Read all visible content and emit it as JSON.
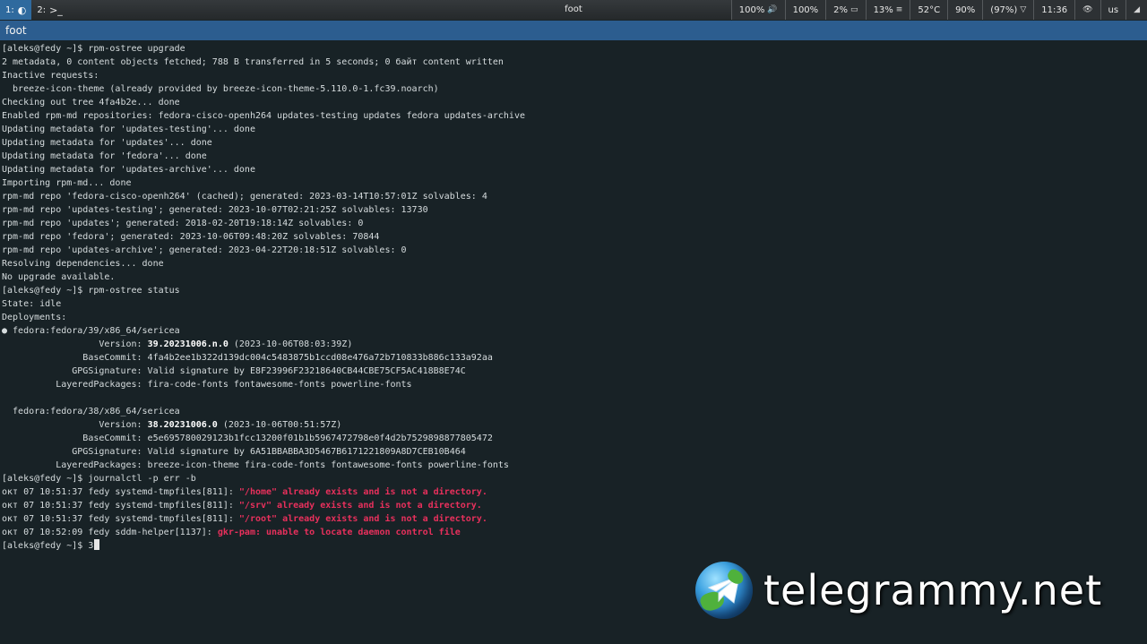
{
  "topbar": {
    "workspaces": [
      {
        "label": "1:",
        "glyph": "◐",
        "icon": "terminal-icon",
        "active": true
      },
      {
        "label": "2:",
        "glyph": ">_",
        "icon": "terminal-icon",
        "active": false
      }
    ],
    "title": "foot",
    "status": [
      {
        "text": "100%",
        "glyph": "🔊",
        "icon": "volume-icon"
      },
      {
        "text": "100%",
        "glyph": "",
        "icon": ""
      },
      {
        "text": "2%",
        "glyph": "▭",
        "icon": "cpu-icon"
      },
      {
        "text": "13%",
        "glyph": "≡",
        "icon": "memory-icon"
      },
      {
        "text": "52°C",
        "glyph": "",
        "icon": ""
      },
      {
        "text": "90%",
        "glyph": "",
        "icon": ""
      },
      {
        "text": "(97%)",
        "glyph": "▽",
        "icon": "wifi-icon"
      },
      {
        "text": "11:36",
        "glyph": "",
        "icon": ""
      },
      {
        "text": "",
        "glyph": "👁",
        "icon": "eye-icon"
      },
      {
        "text": "us",
        "glyph": "",
        "icon": ""
      },
      {
        "text": "",
        "glyph": "◢",
        "icon": "network-signal-icon"
      }
    ]
  },
  "window": {
    "title": "foot"
  },
  "terminal": {
    "lines": [
      [
        {
          "t": "[aleks@fedy ~]$ rpm-ostree upgrade"
        }
      ],
      [
        {
          "t": "2 metadata, 0 content objects fetched; 788 B transferred in 5 seconds; 0 байт content written"
        }
      ],
      [
        {
          "t": "Inactive requests:"
        }
      ],
      [
        {
          "t": "  breeze-icon-theme (already provided by breeze-icon-theme-5.110.0-1.fc39.noarch)"
        }
      ],
      [
        {
          "t": "Checking out tree 4fa4b2e... done"
        }
      ],
      [
        {
          "t": "Enabled rpm-md repositories: fedora-cisco-openh264 updates-testing updates fedora updates-archive"
        }
      ],
      [
        {
          "t": "Updating metadata for 'updates-testing'... done"
        }
      ],
      [
        {
          "t": "Updating metadata for 'updates'... done"
        }
      ],
      [
        {
          "t": "Updating metadata for 'fedora'... done"
        }
      ],
      [
        {
          "t": "Updating metadata for 'updates-archive'... done"
        }
      ],
      [
        {
          "t": "Importing rpm-md... done"
        }
      ],
      [
        {
          "t": "rpm-md repo 'fedora-cisco-openh264' (cached); generated: 2023-03-14T10:57:01Z solvables: 4"
        }
      ],
      [
        {
          "t": "rpm-md repo 'updates-testing'; generated: 2023-10-07T02:21:25Z solvables: 13730"
        }
      ],
      [
        {
          "t": "rpm-md repo 'updates'; generated: 2018-02-20T19:18:14Z solvables: 0"
        }
      ],
      [
        {
          "t": "rpm-md repo 'fedora'; generated: 2023-10-06T09:48:20Z solvables: 70844"
        }
      ],
      [
        {
          "t": "rpm-md repo 'updates-archive'; generated: 2023-04-22T20:18:51Z solvables: 0"
        }
      ],
      [
        {
          "t": "Resolving dependencies... done"
        }
      ],
      [
        {
          "t": "No upgrade available."
        }
      ],
      [
        {
          "t": "[aleks@fedy ~]$ rpm-ostree status"
        }
      ],
      [
        {
          "t": "State: idle"
        }
      ],
      [
        {
          "t": "Deployments:"
        }
      ],
      [
        {
          "t": "● fedora:fedora/39/x86_64/sericea"
        }
      ],
      [
        {
          "t": "                  Version: "
        },
        {
          "t": "39.20231006.n.0",
          "s": "b"
        },
        {
          "t": " (2023-10-06T08:03:39Z)"
        }
      ],
      [
        {
          "t": "               BaseCommit: 4fa4b2ee1b322d139dc004c5483875b1ccd08e476a72b710833b886c133a92aa"
        }
      ],
      [
        {
          "t": "             GPGSignature: Valid signature by E8F23996F23218640CB44CBE75CF5AC418B8E74C"
        }
      ],
      [
        {
          "t": "          LayeredPackages: fira-code-fonts fontawesome-fonts powerline-fonts"
        }
      ],
      [
        {
          "t": ""
        }
      ],
      [
        {
          "t": "  fedora:fedora/38/x86_64/sericea"
        }
      ],
      [
        {
          "t": "                  Version: "
        },
        {
          "t": "38.20231006.0",
          "s": "b"
        },
        {
          "t": " (2023-10-06T00:51:57Z)"
        }
      ],
      [
        {
          "t": "               BaseCommit: e5e695780029123b1fcc13200f01b1b5967472798e0f4d2b7529898877805472"
        }
      ],
      [
        {
          "t": "             GPGSignature: Valid signature by 6A51BBABBA3D5467B6171221809A8D7CEB10B464"
        }
      ],
      [
        {
          "t": "          LayeredPackages: breeze-icon-theme fira-code-fonts fontawesome-fonts powerline-fonts"
        }
      ],
      [
        {
          "t": "[aleks@fedy ~]$ journalctl -p err -b"
        }
      ],
      [
        {
          "t": "окт 07 10:51:37 fedy systemd-tmpfiles[811]: "
        },
        {
          "t": "\"/home\" already exists and is not a directory.",
          "s": "err"
        }
      ],
      [
        {
          "t": "окт 07 10:51:37 fedy systemd-tmpfiles[811]: "
        },
        {
          "t": "\"/srv\" already exists and is not a directory.",
          "s": "err"
        }
      ],
      [
        {
          "t": "окт 07 10:51:37 fedy systemd-tmpfiles[811]: "
        },
        {
          "t": "\"/root\" already exists and is not a directory.",
          "s": "err"
        }
      ],
      [
        {
          "t": "окт 07 10:52:09 fedy sddm-helper[1137]: "
        },
        {
          "t": "gkr-pam: unable to locate daemon control file",
          "s": "err"
        }
      ]
    ],
    "prompt": "[aleks@fedy ~]$ ",
    "input": "3"
  },
  "watermark": {
    "text": "telegrammy.net",
    "icon": "telegram-globe-icon"
  },
  "colors": {
    "terminal_bg": "#182226",
    "terminal_fg": "#d6dcde",
    "error": "#e8305c",
    "titlebar": "#2c5d8f",
    "active_workspace": "#2f6a9e"
  }
}
